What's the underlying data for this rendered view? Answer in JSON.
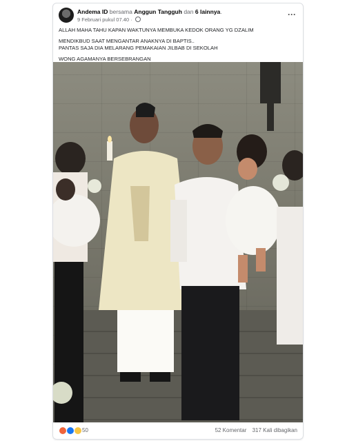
{
  "post": {
    "author": "Andema ID",
    "with_text": "bersama",
    "tagged": "Anggun Tangguh",
    "and_text": "dan",
    "others": "6 lainnya",
    "timestamp": "9 Februari pukul 07.40",
    "privacy_icon": "globe-icon",
    "menu_icon": "more-horizontal-icon",
    "lines": [
      "ALLAH MAHA TAHU KAPAN WAKTUNYA MEMBUKA KEDOK ORANG YG DZALIM",
      "MENDIKBUD SAAT MENGANTAR ANAKNYA DI BAPTIS..",
      "PANTAS SAJA DIA MELARANG PEMAKAIAN JILBAB DI SEKOLAH",
      "WONG AGAMANYA BERSEBRANGAN"
    ]
  },
  "stats": {
    "reaction_icons": [
      "angry-icon",
      "like-icon",
      "haha-icon"
    ],
    "reaction_count": "50",
    "comments": "52 Komentar",
    "shares": "317 Kali dibagikan"
  },
  "colors": {
    "angry": "#f0643c",
    "like": "#1877f2",
    "haha": "#f7c544",
    "muted_text": "#65676b",
    "name_text": "#050505"
  }
}
